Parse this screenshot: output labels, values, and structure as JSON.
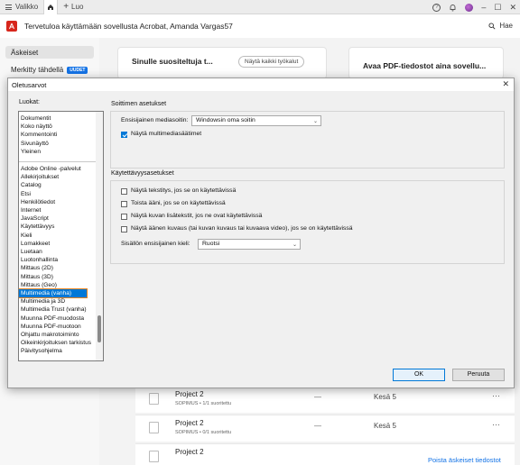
{
  "chrome": {
    "menu_label": "Valikko",
    "new_tab_label": "Luo",
    "welcome_text": "Tervetuloa käyttämään sovellusta Acrobat, Amanda Vargas57",
    "search_label": "Hae"
  },
  "sidebar": {
    "items": [
      {
        "label": "Äskeiset"
      },
      {
        "label": "Merkitty tähdellä",
        "badge": "UUDET"
      }
    ]
  },
  "cards": {
    "tools_title": "Sinulle suositeltuja t...",
    "tools_button": "Näytä kaikki työkalut",
    "pdf_title": "Avaa PDF-tiedostot aina sovellu..."
  },
  "recent_rows": [
    {
      "name": "Project 2",
      "meta": "SOPIMUS  •  1/1 suoritettu",
      "dash": "—",
      "date": "Kesä 5"
    },
    {
      "name": "Project 2",
      "meta": "SOPIMUS  •  0/1 suoritettu",
      "dash": "—",
      "date": "Kesä 5"
    },
    {
      "name": "Project 2",
      "meta": "",
      "dash": "",
      "date": ""
    }
  ],
  "delete_link": "Poista äskeiset tiedostot",
  "dialog": {
    "title": "Oletusarvot",
    "categories_label": "Luokat:",
    "categories_top": [
      "Dokumentit",
      "Koko näyttö",
      "Kommentointi",
      "Sivunäyttö",
      "Yleinen"
    ],
    "categories": [
      "Adobe Online -palvelut",
      "Allekirjoitukset",
      "Catalog",
      "Etsi",
      "Henkilötiedot",
      "Internet",
      "JavaScript",
      "Käytettävyys",
      "Kieli",
      "Lomakkeet",
      "Luetaan",
      "Luotonhallinta",
      "Mittaus (2D)",
      "Mittaus (3D)",
      "Mittaus (Geo)",
      "Multimedia (vanha)",
      "Multimedia ja 3D",
      "Multimedia Trust (vanha)",
      "Muunna PDF-muodosta",
      "Muunna PDF-muotoon",
      "Ohjattu makrotoiminto",
      "Oikeinkirjoituksen tarkistus",
      "Päivitysohjelma"
    ],
    "selected_category": "Multimedia (vanha)",
    "player_group": {
      "title": "Soittimen asetukset",
      "media_player_label": "Ensisijainen mediasoitin:",
      "media_player_value": "Windowsin oma soitin",
      "show_controls_label": "Näytä multimediasäätimet",
      "show_controls_checked": true
    },
    "accessibility_group": {
      "title": "Käytettävyysasetukset",
      "options": [
        {
          "label": "Näytä tekstitys, jos se on käytettävissä",
          "checked": false
        },
        {
          "label": "Toista ääni, jos se on käytettävissä",
          "checked": false
        },
        {
          "label": "Näytä kuvan lisätekstit, jos ne ovat käytettävissä",
          "checked": false
        },
        {
          "label": "Näytä äänen kuvaus (tai kuvan kuvaus tai kuvaava video), jos se on käytettävissä",
          "checked": false
        }
      ],
      "language_label": "Sisällön ensisijainen kieli:",
      "language_value": "Ruotsi"
    },
    "ok_label": "OK",
    "cancel_label": "Peruuta"
  }
}
